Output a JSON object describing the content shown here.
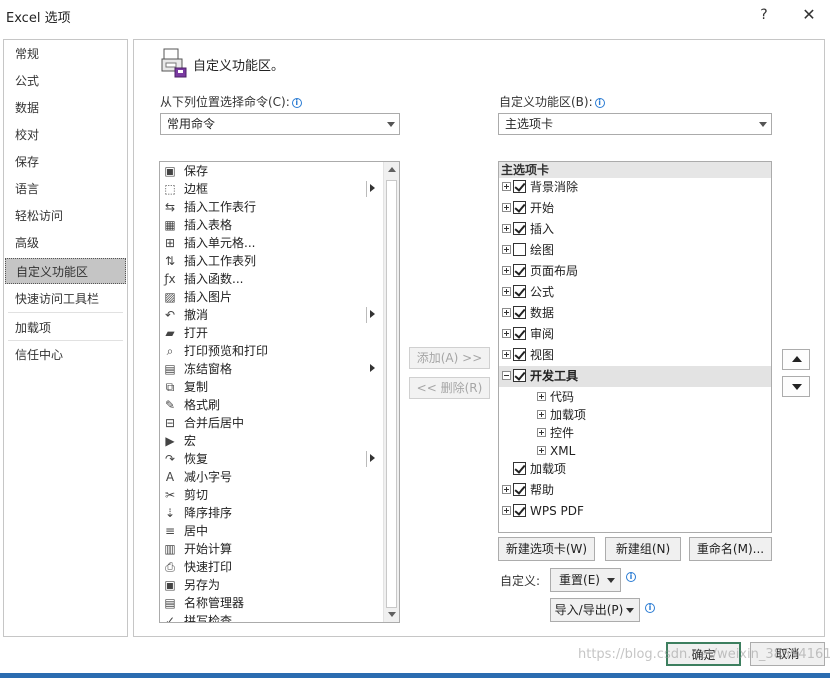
{
  "window": {
    "title": "Excel 选项",
    "help": "?",
    "close": "✕"
  },
  "nav": {
    "items": [
      "常规",
      "公式",
      "数据",
      "校对",
      "保存",
      "语言",
      "轻松访问",
      "高级",
      "自定义功能区",
      "快速访问工具栏",
      "加载项",
      "信任中心"
    ],
    "active": "自定义功能区"
  },
  "header": {
    "title": "自定义功能区。"
  },
  "left": {
    "choose_label": "从下列位置选择命令(C):",
    "choose_value": "常用命令",
    "commands": [
      {
        "icon": "save-icon",
        "glyph": "▣",
        "label": "保存"
      },
      {
        "icon": "border-icon",
        "glyph": "⬚",
        "label": "边框"
      },
      {
        "icon": "insert-row-icon",
        "glyph": "⇆",
        "label": "插入工作表行"
      },
      {
        "icon": "insert-table-icon",
        "glyph": "▦",
        "label": "插入表格"
      },
      {
        "icon": "insert-cells-icon",
        "glyph": "⊞",
        "label": "插入单元格..."
      },
      {
        "icon": "insert-column-icon",
        "glyph": "⇅",
        "label": "插入工作表列"
      },
      {
        "icon": "function-icon",
        "glyph": "ƒx",
        "label": "插入函数..."
      },
      {
        "icon": "picture-icon",
        "glyph": "▨",
        "label": "插入图片"
      },
      {
        "icon": "undo-icon",
        "glyph": "↶",
        "label": "撤消"
      },
      {
        "icon": "open-folder-icon",
        "glyph": "▰",
        "label": "打开"
      },
      {
        "icon": "print-preview-icon",
        "glyph": "⌕",
        "label": "打印预览和打印"
      },
      {
        "icon": "freeze-panes-icon",
        "glyph": "▤",
        "label": "冻结窗格"
      },
      {
        "icon": "copy-icon",
        "glyph": "⧉",
        "label": "复制"
      },
      {
        "icon": "format-painter-icon",
        "glyph": "✎",
        "label": "格式刷"
      },
      {
        "icon": "merge-center-icon",
        "glyph": "⊟",
        "label": "合并后居中"
      },
      {
        "icon": "macro-icon",
        "glyph": "▶",
        "label": "宏"
      },
      {
        "icon": "redo-icon",
        "glyph": "↷",
        "label": "恢复"
      },
      {
        "icon": "decrease-font-icon",
        "glyph": "A",
        "label": "减小字号"
      },
      {
        "icon": "cut-icon",
        "glyph": "✂",
        "label": "剪切"
      },
      {
        "icon": "sort-descending-icon",
        "glyph": "⇣",
        "label": "降序排序"
      },
      {
        "icon": "center-icon",
        "glyph": "≡",
        "label": "居中"
      },
      {
        "icon": "calculator-icon",
        "glyph": "▥",
        "label": "开始计算"
      },
      {
        "icon": "quick-print-icon",
        "glyph": "⎙",
        "label": "快速打印"
      },
      {
        "icon": "save-as-icon",
        "glyph": "▣",
        "label": "另存为"
      },
      {
        "icon": "name-manager-icon",
        "glyph": "▤",
        "label": "名称管理器"
      },
      {
        "icon": "spelling-icon",
        "glyph": "✓",
        "label": "拼写检查"
      }
    ]
  },
  "middle": {
    "add": "添加(A) >>",
    "remove": "<< 删除(R)"
  },
  "right": {
    "customize_label": "自定义功能区(B):",
    "customize_value": "主选项卡",
    "tree_header": "主选项卡",
    "tabs": [
      {
        "label": "背景消除",
        "checked": true
      },
      {
        "label": "开始",
        "checked": true
      },
      {
        "label": "插入",
        "checked": true
      },
      {
        "label": "绘图",
        "checked": false
      },
      {
        "label": "页面布局",
        "checked": true
      },
      {
        "label": "公式",
        "checked": true
      },
      {
        "label": "数据",
        "checked": true
      },
      {
        "label": "审阅",
        "checked": true
      },
      {
        "label": "视图",
        "checked": true
      },
      {
        "label": "开发工具",
        "checked": true
      }
    ],
    "dev_groups": [
      "代码",
      "加载项",
      "控件",
      "XML"
    ],
    "tabs_after": [
      {
        "label": "加载项",
        "checked": true,
        "expander": false
      },
      {
        "label": "帮助",
        "checked": true,
        "expander": true
      },
      {
        "label": "WPS PDF",
        "checked": true,
        "expander": true
      }
    ],
    "new_tab": "新建选项卡(W)",
    "new_group": "新建组(N)",
    "rename": "重命名(M)...",
    "customize_text": "自定义:",
    "reset": "重置(E)",
    "import_export": "导入/导出(P)"
  },
  "footer": {
    "ok": "确定",
    "cancel": "取消"
  },
  "watermark": "https://blog.csdn.net/weixin_38594161"
}
